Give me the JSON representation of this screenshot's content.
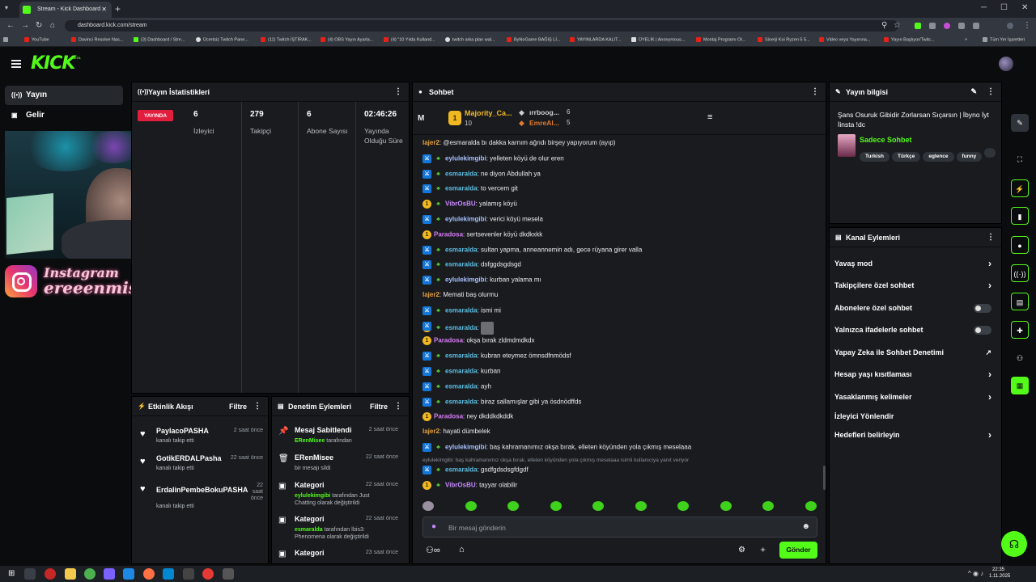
{
  "browser": {
    "tab_title": "Stream - Kick Dashboard",
    "url": "dashboard.kick.com/stream",
    "bookmarks": [
      "YouTube",
      "Davinci Resolve Nas...",
      "(3) Dashboard / Stre...",
      "Ücretsiz Twitch Pane...",
      "(11) Twitch İŞTİRAK...",
      "(4) OBS Yayın Ayarla...",
      "(4) \"10 Yılda Kulland...",
      "twitch arka plan wal...",
      "ByNoGame BAĞIŞ Lİ...",
      "YAYINLARDA KALIT...",
      "ÜYELİK | Anonymous...",
      "Montaj Programı Ol...",
      "Sinerji Koi Ryzen 5 5...",
      "Video veya Yayınına...",
      "Yayın Başlıyor/Twitc...",
      "»",
      "Tüm Yer İşaretleri"
    ]
  },
  "app": {
    "logo": "KICK",
    "beta": "BETA"
  },
  "nav": {
    "items": [
      {
        "label": "Yayın",
        "icon": "stream-icon"
      },
      {
        "label": "Gelir",
        "icon": "revenue-icon"
      }
    ]
  },
  "overlay": {
    "instagram_title": "Instagram",
    "instagram_handle": "ereeenmise"
  },
  "stats": {
    "title": "Yayın İstatistikleri",
    "live_label": "YAYINDA",
    "items": [
      {
        "value": "6",
        "label": "İzleyici"
      },
      {
        "value": "279",
        "label": "Takipçi"
      },
      {
        "value": "6",
        "label": "Abone Sayısı"
      },
      {
        "value": "02:46:26",
        "label": "Yayında Olduğu Süre"
      }
    ]
  },
  "activity": {
    "title": "Etkinlik Akışı",
    "filter": "Filtre",
    "events": [
      {
        "name": "PaylacoPASHA",
        "sub": "kanalı takip etti",
        "time": "2 saat önce"
      },
      {
        "name": "GotikERDALPasha",
        "sub": "kanalı takip etti",
        "time": "22 saat önce"
      },
      {
        "name": "ErdalinPembeBokuPASHA",
        "sub": "kanalı takip etti",
        "time": "22 saat önce"
      }
    ]
  },
  "modlog": {
    "title": "Denetim Eylemleri",
    "filter": "Filtre",
    "items": [
      {
        "icon": "pin-icon",
        "name": "Mesaj Sabitlendi",
        "user": "ERenMisee",
        "sub": " tarafından",
        "time": "2 saat önce"
      },
      {
        "icon": "trash-icon",
        "name": "ERenMisee",
        "user": "",
        "sub": "bir mesajı sildi",
        "time": "22 saat önce"
      },
      {
        "icon": "category-icon",
        "name": "Kategori",
        "user": "eylulekimgibi",
        "sub": " tarafından Just Chatting olarak değiştirildi",
        "time": "22 saat önce"
      },
      {
        "icon": "category-icon",
        "name": "Kategori",
        "user": "esmaralda",
        "sub": " tarafından İbis3: Phenomena olarak değiştirildi",
        "time": "22 saat önce"
      },
      {
        "icon": "category-icon",
        "name": "Kategori",
        "user": "",
        "sub": "",
        "time": "23 saat önce"
      }
    ]
  },
  "chat": {
    "title": "Sohbet",
    "top_label": "M",
    "leaders": [
      {
        "name": "Majority_Ca...",
        "count": "10",
        "color": "#f0b821"
      },
      {
        "name": "ırrboog...",
        "count": "6",
        "color": "#d0d0d0"
      },
      {
        "name": "EmreAl...",
        "count": "5",
        "color": "#e07b30"
      }
    ],
    "messages": [
      {
        "badges": [],
        "user": "lajer2",
        "color": "#e9a23b",
        "text": ": @esmaralda bı dakka karnım ağrıdı birşey yapıyorum (ayıp)"
      },
      {
        "badges": [
          "mod",
          "sub",
          "leaf"
        ],
        "user": "eylulekimgibi",
        "color": "#a8c0ff",
        "text": ": yelleten köyü de olur eren"
      },
      {
        "badges": [
          "mod",
          "sub",
          "leaf"
        ],
        "user": "esmaralda",
        "color": "#5dc1e6",
        "text": ": ne diyon Abdullah ya"
      },
      {
        "badges": [
          "mod",
          "sub",
          "leaf"
        ],
        "user": "esmaralda",
        "color": "#5dc1e6",
        "text": ": to vercem git"
      },
      {
        "badges": [
          "sub",
          "leaf"
        ],
        "user": "VibrOsBU",
        "color": "#c789ff",
        "text": ": yalamış köyü"
      },
      {
        "badges": [
          "mod",
          "sub",
          "leaf"
        ],
        "user": "eylulekimgibi",
        "color": "#a8c0ff",
        "text": ": verici köyü mesela"
      },
      {
        "badges": [
          "sub"
        ],
        "user": "Paradosa",
        "color": "#d67cf5",
        "text": ": sertsevenler köyü dkdkxkk"
      },
      {
        "badges": [
          "mod",
          "sub",
          "leaf"
        ],
        "user": "esmaralda",
        "color": "#5dc1e6",
        "text": ": sultan yapma, anneannemin adı, gece rüyana girer valla"
      },
      {
        "badges": [
          "mod",
          "sub",
          "leaf"
        ],
        "user": "esmaralda",
        "color": "#5dc1e6",
        "text": ": dsfggdsgdsgd"
      },
      {
        "badges": [
          "mod",
          "sub",
          "leaf"
        ],
        "user": "eylulekimgibi",
        "color": "#a8c0ff",
        "text": ": kurban yalama mı"
      },
      {
        "badges": [],
        "user": "lajer2",
        "color": "#e9a23b",
        "text": ": Memati baş olurmu"
      },
      {
        "badges": [
          "mod",
          "sub",
          "leaf"
        ],
        "user": "esmaralda",
        "color": "#5dc1e6",
        "text": ": ismi mi"
      },
      {
        "badges": [
          "mod",
          "sub",
          "leaf"
        ],
        "user": "esmaralda",
        "color": "#5dc1e6",
        "text": ": "
      },
      {
        "badges": [
          "sub"
        ],
        "user": "Paradosa",
        "color": "#d67cf5",
        "text": ": okşa bırak zldmdmdkdx"
      },
      {
        "badges": [
          "mod",
          "sub",
          "leaf"
        ],
        "user": "esmaralda",
        "color": "#5dc1e6",
        "text": ": kubran eteymez ömnsdfnmödsf"
      },
      {
        "badges": [
          "mod",
          "sub",
          "leaf"
        ],
        "user": "esmaralda",
        "color": "#5dc1e6",
        "text": ": kurban"
      },
      {
        "badges": [
          "mod",
          "sub",
          "leaf"
        ],
        "user": "esmaralda",
        "color": "#5dc1e6",
        "text": ": ayh"
      },
      {
        "badges": [
          "mod",
          "sub",
          "leaf"
        ],
        "user": "esmaralda",
        "color": "#5dc1e6",
        "text": ": biraz sallamışlar gibi ya ösdnödffds"
      },
      {
        "badges": [
          "sub"
        ],
        "user": "Paradosa",
        "color": "#d67cf5",
        "text": ": ney dkddkdkddk"
      },
      {
        "badges": [],
        "user": "lajer2",
        "color": "#e9a23b",
        "text": ": hayati dümbelek"
      },
      {
        "badges": [
          "mod",
          "sub",
          "leaf"
        ],
        "user": "eylulekimgibi",
        "color": "#a8c0ff",
        "text": ": baş kahramanımız okşa bırak, elleten köyünden yola çıkmış meselaaa"
      }
    ],
    "reply_hint": "eylulekimgibi: baş kahramanımız okşa bırak, elleten köyünden yola çıkmış meselaaa isimli kullanıcıya yanıt veriyor",
    "reply_msg": {
      "user": "esmaralda",
      "text": ": gsdfgdsdsgfdgdf"
    },
    "last_msg": {
      "user": "VibrOsBU",
      "text": ": tayyar olabilir"
    },
    "input_placeholder": "Bir mesaj gönderin",
    "send_label": "Gönder"
  },
  "streaminfo": {
    "title": "Yayın bilgisi",
    "stream_title": "Şans Osuruk Gibidir Zorlarsan Sıçarsın | İbyno İyt İinsta !dc",
    "category": "Sadece Sohbet",
    "tags": [
      "Turkish",
      "Türkçe",
      "eglence",
      "funny"
    ]
  },
  "channelactions": {
    "title": "Kanal Eylemleri",
    "items": [
      {
        "label": "Yavaş mod",
        "control": "chevron"
      },
      {
        "label": "Takipçilere özel sohbet",
        "control": "chevron"
      },
      {
        "label": "Abonelere özel sohbet",
        "control": "toggle"
      },
      {
        "label": "Yalnızca ifadelerle sohbet",
        "control": "toggle"
      },
      {
        "label": "Yapay Zeka ile Sohbet Denetimi",
        "control": "external"
      },
      {
        "label": "Hesap yaşı kısıtlaması",
        "control": "chevron"
      },
      {
        "label": "Yasaklanmış kelimeler",
        "control": "chevron"
      },
      {
        "label": "İzleyici Yönlendir",
        "control": "none"
      },
      {
        "label": "Hedefleri belirleyin",
        "control": "chevron"
      }
    ]
  },
  "taskbar": {
    "time": "22:35",
    "date": "1.11.2025"
  },
  "colors": {
    "accent": "#53fc18",
    "live": "#e11e3d",
    "panel": "#191b1f",
    "bg": "#0b0c0e"
  }
}
